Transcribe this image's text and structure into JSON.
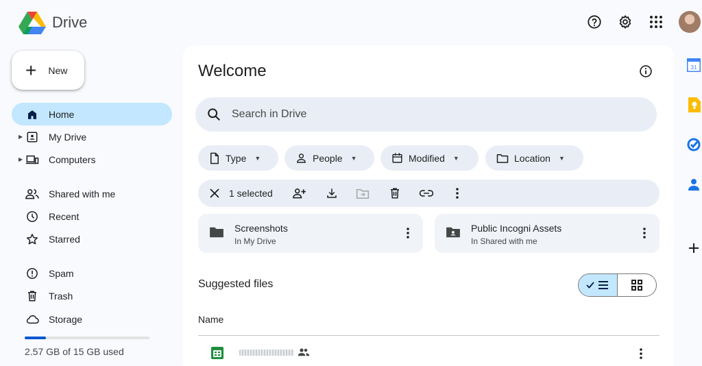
{
  "app": {
    "name": "Drive"
  },
  "header": {
    "icons": [
      "help-icon",
      "settings-icon",
      "apps-grid-icon"
    ],
    "avatar": "account-avatar"
  },
  "sidebar": {
    "new_label": "New",
    "items": [
      {
        "label": "Home",
        "icon": "home-icon",
        "active": true
      },
      {
        "label": "My Drive",
        "icon": "my-drive-icon"
      },
      {
        "label": "Computers",
        "icon": "computers-icon"
      },
      {
        "label": "Shared with me",
        "icon": "shared-icon"
      },
      {
        "label": "Recent",
        "icon": "clock-icon"
      },
      {
        "label": "Starred",
        "icon": "star-icon"
      },
      {
        "label": "Spam",
        "icon": "spam-icon"
      },
      {
        "label": "Trash",
        "icon": "trash-icon"
      },
      {
        "label": "Storage",
        "icon": "cloud-icon"
      }
    ],
    "storage": {
      "text": "2.57 GB of 15 GB used",
      "used_fraction": 0.171
    }
  },
  "main": {
    "title": "Welcome",
    "search": {
      "placeholder": "Search in Drive"
    },
    "filters": [
      {
        "label": "Type",
        "icon": "file-icon"
      },
      {
        "label": "People",
        "icon": "person-icon"
      },
      {
        "label": "Modified",
        "icon": "calendar-icon"
      },
      {
        "label": "Location",
        "icon": "folder-outline-icon"
      }
    ],
    "selection": {
      "count_label": "1 selected"
    },
    "folders": [
      {
        "name": "Screenshots",
        "location": "In My Drive"
      },
      {
        "name": "Public Incogni Assets",
        "location": "In Shared with me"
      }
    ],
    "suggested_title": "Suggested files",
    "column_name": "Name"
  },
  "colors": {
    "accent": "#0b57d0",
    "active_nav": "#c2e7ff",
    "surface": "#e9eef6"
  }
}
